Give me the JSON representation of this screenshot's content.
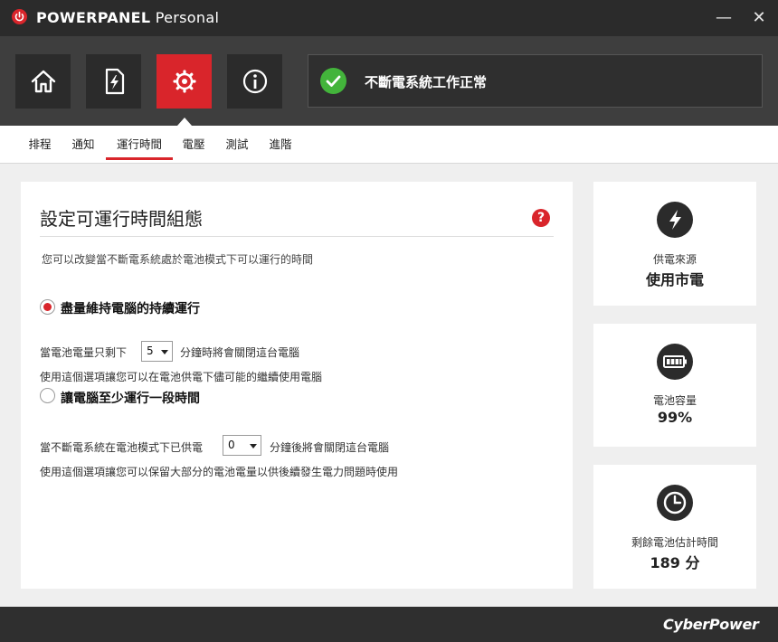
{
  "window": {
    "title_bold": "POWERPANEL",
    "title_rest": " Personal",
    "minimize_glyph": "—",
    "close_glyph": "✕"
  },
  "toolbar": {
    "buttons": [
      {
        "icon": "home-icon",
        "active": false
      },
      {
        "icon": "lightning-document-icon",
        "active": false
      },
      {
        "icon": "gear-icon",
        "active": true
      },
      {
        "icon": "info-icon",
        "active": false
      }
    ],
    "status": {
      "icon": "check-circle-icon",
      "text": "不斷電系統工作正常",
      "color": "#43b43b"
    }
  },
  "tabs": [
    {
      "label": "排程",
      "active": false
    },
    {
      "label": "通知",
      "active": false
    },
    {
      "label": "運行時間",
      "active": true
    },
    {
      "label": "電壓",
      "active": false
    },
    {
      "label": "測試",
      "active": false
    },
    {
      "label": "進階",
      "active": false
    }
  ],
  "panel": {
    "title": "設定可運行時間組態",
    "help_glyph": "?",
    "description": "您可以改變當不斷電系統處於電池模式下可以運行的時間",
    "option1": {
      "label": "盡量維持電腦的持續運行",
      "selected": true,
      "line_before": "當電池電量只剩下",
      "select_value": "5",
      "line_after": "分鐘時將會關閉這台電腦",
      "hint": "使用這個選項讓您可以在電池供電下儘可能的繼續使用電腦"
    },
    "option2": {
      "label": "讓電腦至少運行一段時間",
      "selected": false,
      "line_before": "當不斷電系統在電池模式下已供電",
      "select_value": "0",
      "line_after": "分鐘後將會關閉這台電腦",
      "hint": "使用這個選項讓您可以保留大部分的電池電量以供後續發生電力問題時使用"
    }
  },
  "cards": [
    {
      "icon": "lightning-icon",
      "label": "供電來源",
      "value": "使用市電"
    },
    {
      "icon": "battery-icon",
      "label": "電池容量",
      "value": "99%"
    },
    {
      "icon": "clock-icon",
      "label": "剩餘電池估計時間",
      "value": "189 分"
    }
  ],
  "footer": {
    "brand": "CyberPower"
  },
  "colors": {
    "accent": "#d9252b",
    "dark": "#2b2b2b",
    "ok": "#43b43b"
  }
}
